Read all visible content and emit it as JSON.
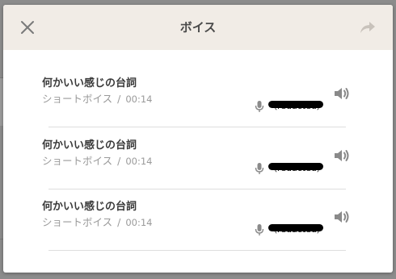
{
  "dialog": {
    "title": "ボイス",
    "close_icon": "close-icon",
    "share_icon": "share-arrow-icon"
  },
  "voices": [
    {
      "title": "何かいい感じの台詞",
      "type": "ショートボイス",
      "separator": "/",
      "duration": "00:14",
      "voice_actor": "（redacted）",
      "play_icon": "speaker-icon",
      "mic_icon": "microphone-icon"
    },
    {
      "title": "何かいい感じの台詞",
      "type": "ショートボイス",
      "separator": "/",
      "duration": "00:14",
      "voice_actor": "（redacted）",
      "play_icon": "speaker-icon",
      "mic_icon": "microphone-icon"
    },
    {
      "title": "何かいい感じの台詞",
      "type": "ショートボイス",
      "separator": "/",
      "duration": "00:14",
      "voice_actor": "（redacted）",
      "play_icon": "speaker-icon",
      "mic_icon": "microphone-icon"
    }
  ],
  "colors": {
    "header_bg": "#f1ece6",
    "title_text": "#3a3a3a",
    "meta_text": "#9a9a9a",
    "icon_gray": "#8a8a8a",
    "overlay": "#8f8f8f"
  }
}
